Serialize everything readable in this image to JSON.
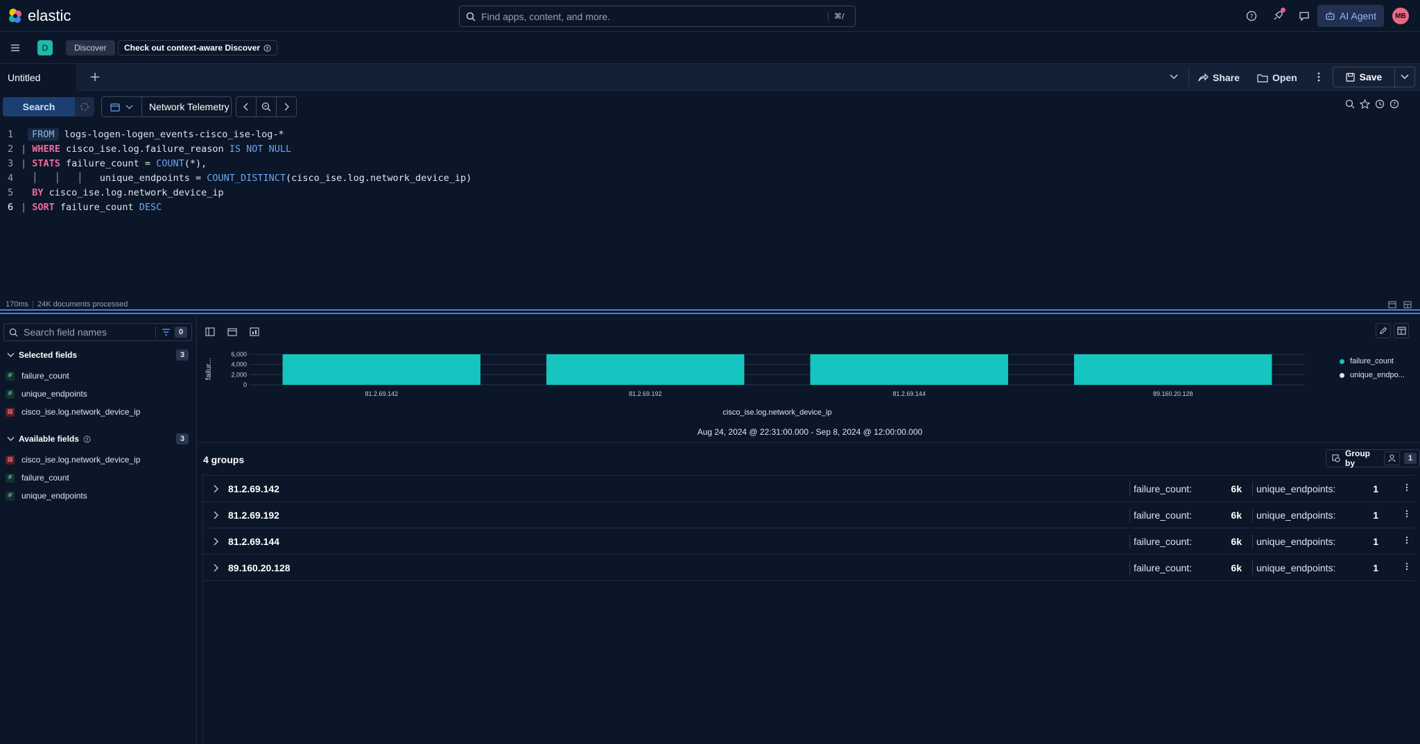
{
  "header": {
    "logo_text": "elastic",
    "search_placeholder": "Find apps, content, and more.",
    "search_shortcut": "⌘/",
    "ai_agent_label": "AI Agent",
    "avatar_initials": "MB"
  },
  "breadcrumb": {
    "app_badge": "D",
    "items": [
      "Discover",
      "Check out context-aware Discover"
    ]
  },
  "tabs": {
    "active": "Untitled",
    "share_label": "Share",
    "open_label": "Open",
    "save_label": "Save"
  },
  "query_bar": {
    "search_label": "Search",
    "data_view": "Network Telemetry"
  },
  "editor": {
    "line_numbers": [
      "1",
      "2",
      "3",
      "4",
      "5",
      "6"
    ],
    "l1_kw": "FROM",
    "l1_rest": " logs-logen-logen_events-cisco_ise-log-*",
    "l2_pipe": "| ",
    "l2_kw": "WHERE",
    "l2_mid": " cisco_ise.log.failure_reason ",
    "l2_kw2": "IS NOT NULL",
    "l3_pipe": "| ",
    "l3_kw": "STATS",
    "l3_mid": " failure_count = ",
    "l3_fn": "COUNT",
    "l3_rest": "(*),",
    "l4_indent": "  │   │   │   ",
    "l4_mid": "unique_endpoints = ",
    "l4_fn": "COUNT_DISTINCT",
    "l4_rest": "(cisco_ise.log.network_device_ip)",
    "l5_indent": "  ",
    "l5_kw": "BY",
    "l5_rest": " cisco_ise.log.network_device_ip",
    "l6_pipe": "| ",
    "l6_kw": "SORT",
    "l6_mid": " failure_count ",
    "l6_kw2": "DESC"
  },
  "status": {
    "duration": "170ms",
    "documents": "24K documents processed"
  },
  "sidebar": {
    "search_placeholder": "Search field names",
    "filter_count": "0",
    "selected_title": "Selected fields",
    "selected_count": "3",
    "selected_fields": [
      {
        "name": "failure_count",
        "type": "#"
      },
      {
        "name": "unique_endpoints",
        "type": "#"
      },
      {
        "name": "cisco_ise.log.network_device_ip",
        "type": "ip"
      }
    ],
    "available_title": "Available fields",
    "available_count": "3",
    "available_fields": [
      {
        "name": "cisco_ise.log.network_device_ip",
        "type": "ip"
      },
      {
        "name": "failure_count",
        "type": "#"
      },
      {
        "name": "unique_endpoints",
        "type": "#"
      }
    ]
  },
  "chart_data": {
    "type": "bar",
    "categories": [
      "81.2.69.142",
      "81.2.69.192",
      "81.2.69.144",
      "89.160.20.128"
    ],
    "series": [
      {
        "name": "failure_count",
        "values": [
          6000,
          6000,
          6000,
          6000
        ],
        "color": "#16c5c0"
      },
      {
        "name": "unique_endpo...",
        "values": [
          1,
          1,
          1,
          1
        ],
        "color": "#dfe5ef"
      }
    ],
    "y_ticks": [
      "6,000",
      "4,000",
      "2,000",
      "0"
    ],
    "ylim": [
      0,
      6000
    ],
    "xlabel": "cisco_ise.log.network_device_ip",
    "ylabel": "failur...",
    "legend_position": "right",
    "grid": true,
    "time_range": "Aug 24, 2024 @ 22:31:00.000 - Sep 8, 2024 @ 12:00:00.000"
  },
  "groups": {
    "title": "4 groups",
    "group_by_label": "Group by",
    "group_by_count": "1",
    "stat1_label": "failure_count:",
    "stat2_label": "unique_endpoints:",
    "rows": [
      {
        "name": "81.2.69.142",
        "failure_count": "6k",
        "unique_endpoints": "1"
      },
      {
        "name": "81.2.69.192",
        "failure_count": "6k",
        "unique_endpoints": "1"
      },
      {
        "name": "81.2.69.144",
        "failure_count": "6k",
        "unique_endpoints": "1"
      },
      {
        "name": "89.160.20.128",
        "failure_count": "6k",
        "unique_endpoints": "1"
      }
    ]
  },
  "colors": {
    "background": "#0b1628",
    "accent": "#16c5c0",
    "primary": "#1c3e70",
    "keyword_pink": "#f26ba0",
    "keyword_blue": "#6aa4f6"
  }
}
